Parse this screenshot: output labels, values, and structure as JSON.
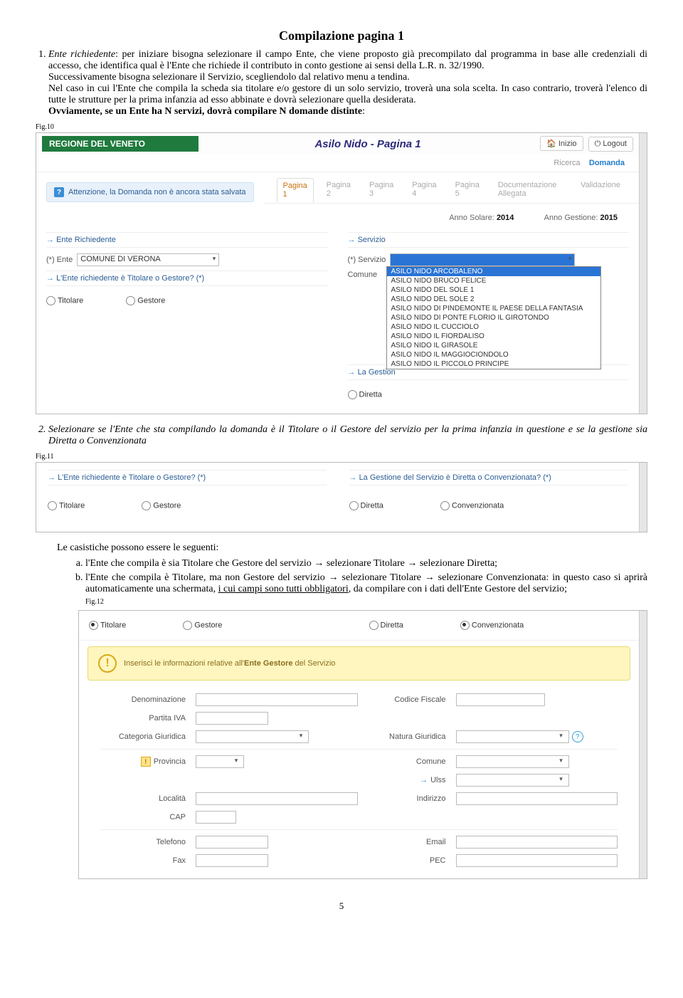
{
  "title": "Compilazione pagina 1",
  "para1_lead_label": "Ente richiedente",
  "para1_a": ": per iniziare bisogna selezionare il campo Ente, che viene proposto già precompilato dal programma in base alle credenziali di accesso, che identifica qual è l'Ente che richiede il contributo in conto gestione ai sensi della L.R. n. 32/1990.",
  "para1_b": "Successivamente bisogna selezionare il Servizio, scegliendolo dal relativo menu a tendina.",
  "para1_c": "Nel caso in cui l'Ente che compila la scheda sia titolare e/o gestore di un solo servizio, troverà una sola scelta. In caso contrario, troverà l'elenco di tutte le strutture per la prima infanzia ad esso abbinate e dovrà selezionare quella desiderata.",
  "para1_d_bold": "Ovviamente, se un Ente ha  N servizi, dovrà compilare N domande distinte",
  "fig10_label": "Fig.10",
  "fig10": {
    "region_banner": "REGIONE DEL VENETO",
    "app_title": "Asilo Nido - Pagina 1",
    "btn_inizio": "Inizio",
    "btn_logout": "Logout",
    "nav_ricerca": "Ricerca",
    "nav_domanda": "Domanda",
    "tabs": [
      "Pagina 1",
      "Pagina 2",
      "Pagina 3",
      "Pagina 4",
      "Pagina 5",
      "Documentazione Allegata",
      "Validazione"
    ],
    "alert": "Attenzione, la Domanda non è ancora stata salvata",
    "anno_solare_label": "Anno Solare:",
    "anno_solare": "2014",
    "anno_gestione_label": "Anno Gestione:",
    "anno_gestione": "2015",
    "sec_ente": "Ente Richiedente",
    "ente_label": "(*)   Ente",
    "ente_value": "COMUNE DI VERONA",
    "ente_q": "L'Ente richiedente è Titolare o Gestore?   (*)",
    "r_titolare": "Titolare",
    "r_gestore": "Gestore",
    "sec_servizio": "Servizio",
    "servizio_label": "(*)   Servizio",
    "comune_label": "Comune",
    "dd_items": [
      "ASILO NIDO ARCOBALENO",
      "ASILO NIDO BRUCO FELICE",
      "ASILO NIDO DEL SOLE 1",
      "ASILO NIDO DEL SOLE 2",
      "ASILO NIDO DI PINDEMONTE IL PAESE DELLA FANTASIA",
      "ASILO NIDO DI PONTE FLORIO IL GIROTONDO",
      "ASILO NIDO IL CUCCIOLO",
      "ASILO NIDO IL FIORDALISO",
      "ASILO NIDO IL GIRASOLE",
      "ASILO NIDO IL MAGGIOCIONDOLO",
      "ASILO NIDO IL PICCOLO PRINCIPE"
    ],
    "gest_q": "La Gestion",
    "r_diretta": "Diretta"
  },
  "para2": "Selezionare se l'Ente che sta compilando la domanda è il Titolare o il Gestore del servizio per la prima infanzia in questione e se la gestione sia Diretta o Convenzionata",
  "fig11_label": "Fig.11",
  "fig11": {
    "q_left": "L'Ente richiedente è Titolare o Gestore?   (*)",
    "r_titolare": "Titolare",
    "r_gestore": "Gestore",
    "q_right": "La Gestione del Servizio è Diretta o Convenzionata?   (*)",
    "r_diretta": "Diretta",
    "r_convenzionata": "Convenzionata"
  },
  "cas_intro": "Le casistiche possono essere le seguenti:",
  "cas_a_1": "l'Ente che compila è sia Titolare che Gestore del servizio ",
  "cas_a_2": " selezionare Titolare ",
  "cas_a_3": " selezionare Diretta;",
  "cas_b_1": "l'Ente che compila è  Titolare, ma non Gestore del servizio ",
  "cas_b_2": " selezionare Titolare ",
  "cas_b_3": " selezionare Convenzionata: in questo caso si aprirà automaticamente una schermata, ",
  "cas_b_under": "i cui campi sono tutti obbligatori",
  "cas_b_4": ", da compilare con i dati dell'Ente Gestore del servizio;",
  "arrow": "→",
  "fig12_label": "Fig.12",
  "fig12": {
    "r_titolare": "Titolare",
    "r_gestore": "Gestore",
    "r_diretta": "Diretta",
    "r_convenzionata": "Convenzionata",
    "banner_a": "Inserisci le informazioni relative all'",
    "banner_b": "Ente Gestore",
    "banner_c": " del Servizio",
    "lbl_denominazione": "Denominazione",
    "lbl_cf": "Codice Fiscale",
    "lbl_piva": "Partita IVA",
    "lbl_catgiur": "Categoria Giuridica",
    "lbl_natgiur": "Natura Giuridica",
    "lbl_provincia": "Provincia",
    "lbl_comune": "Comune",
    "lbl_ulss": "Ulss",
    "lbl_localita": "Località",
    "lbl_indirizzo": "Indirizzo",
    "lbl_cap": "CAP",
    "lbl_telefono": "Telefono",
    "lbl_email": "Email",
    "lbl_fax": "Fax",
    "lbl_pec": "PEC"
  },
  "page_number": "5"
}
